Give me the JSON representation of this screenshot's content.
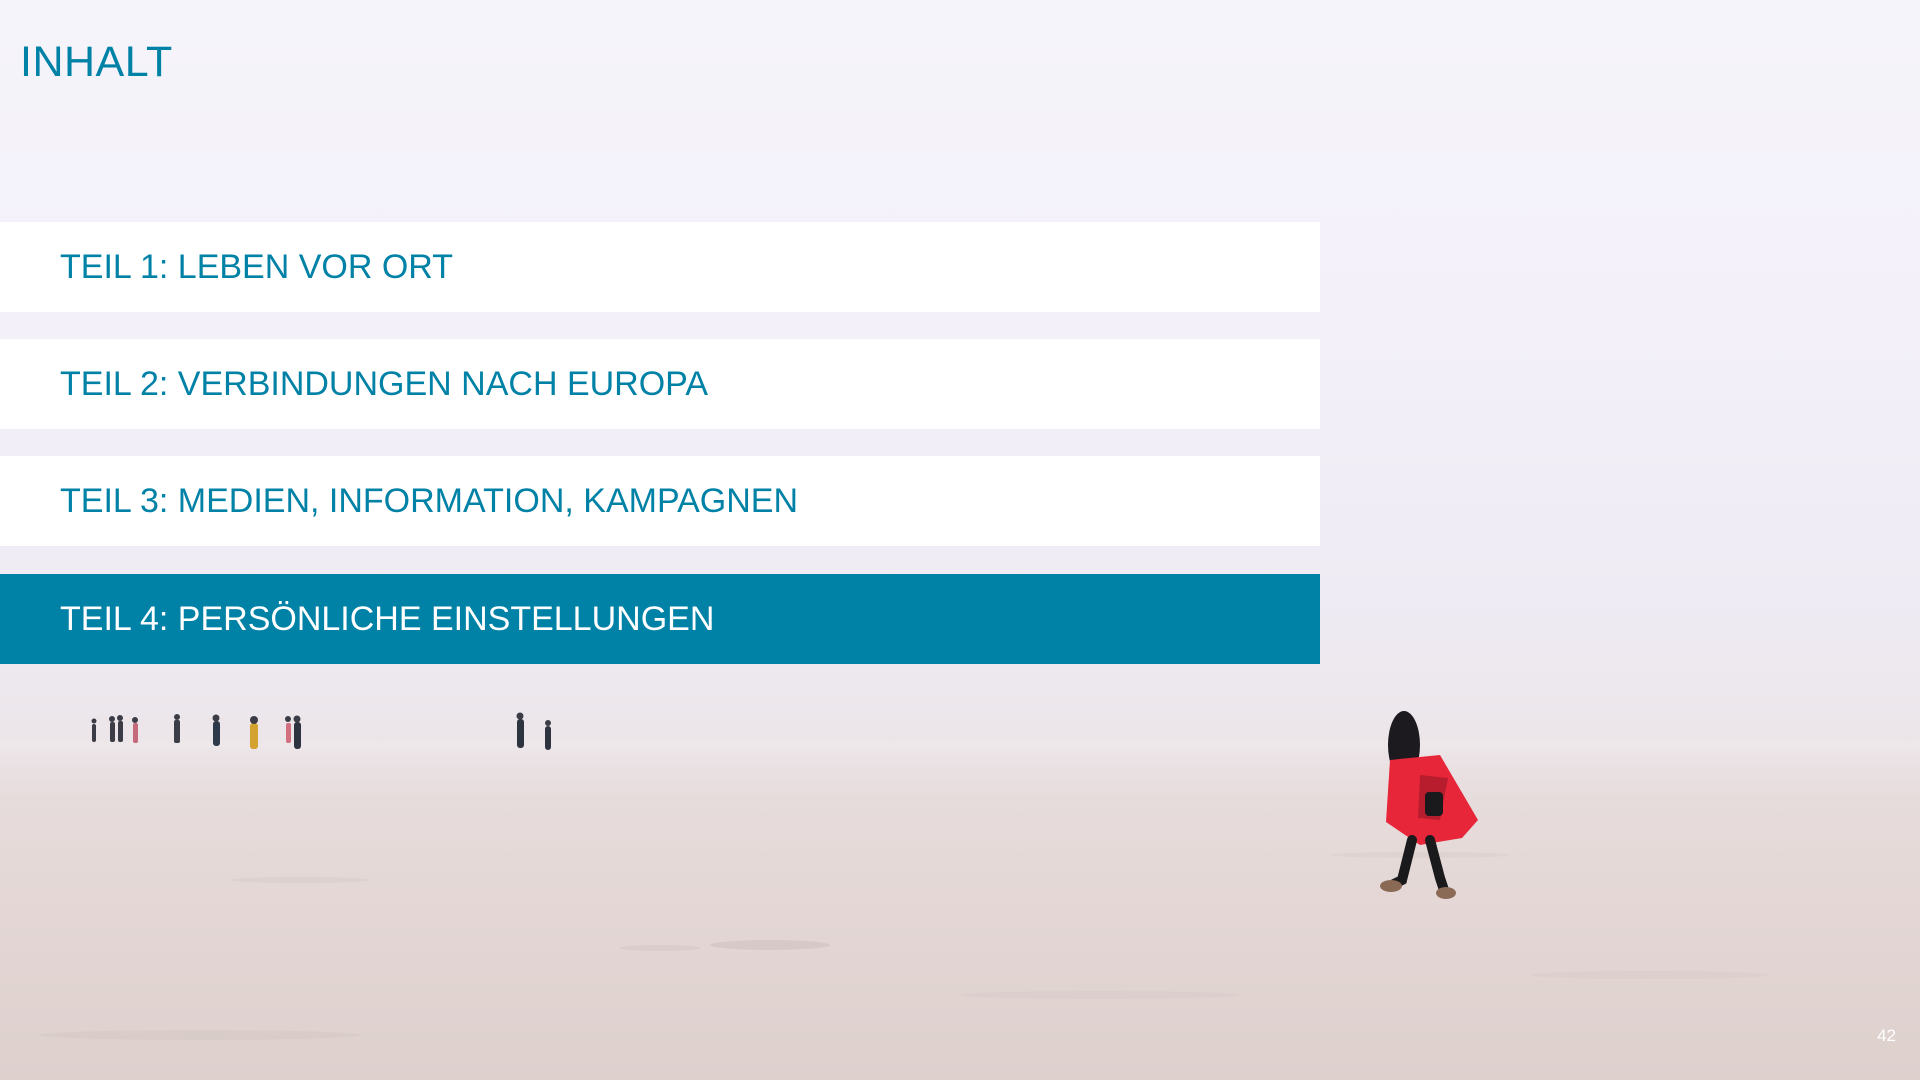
{
  "title": "INHALT",
  "agenda": [
    {
      "label": "TEIL 1: LEBEN VOR ORT",
      "active": false
    },
    {
      "label": "TEIL 2: VERBINDUNGEN NACH EUROPA",
      "active": false
    },
    {
      "label": "TEIL 3: MEDIEN, INFORMATION, KAMPAGNEN",
      "active": false
    },
    {
      "label": "TEIL 4: PERSÖNLICHE EINSTELLUNGEN",
      "active": true
    }
  ],
  "page_number": "42",
  "colors": {
    "accent": "#0081a6",
    "active_text": "#ffffff",
    "item_bg": "#ffffff"
  },
  "background": {
    "scene": "foggy salt flat with walking people",
    "figure_coat": "#e8263a"
  }
}
